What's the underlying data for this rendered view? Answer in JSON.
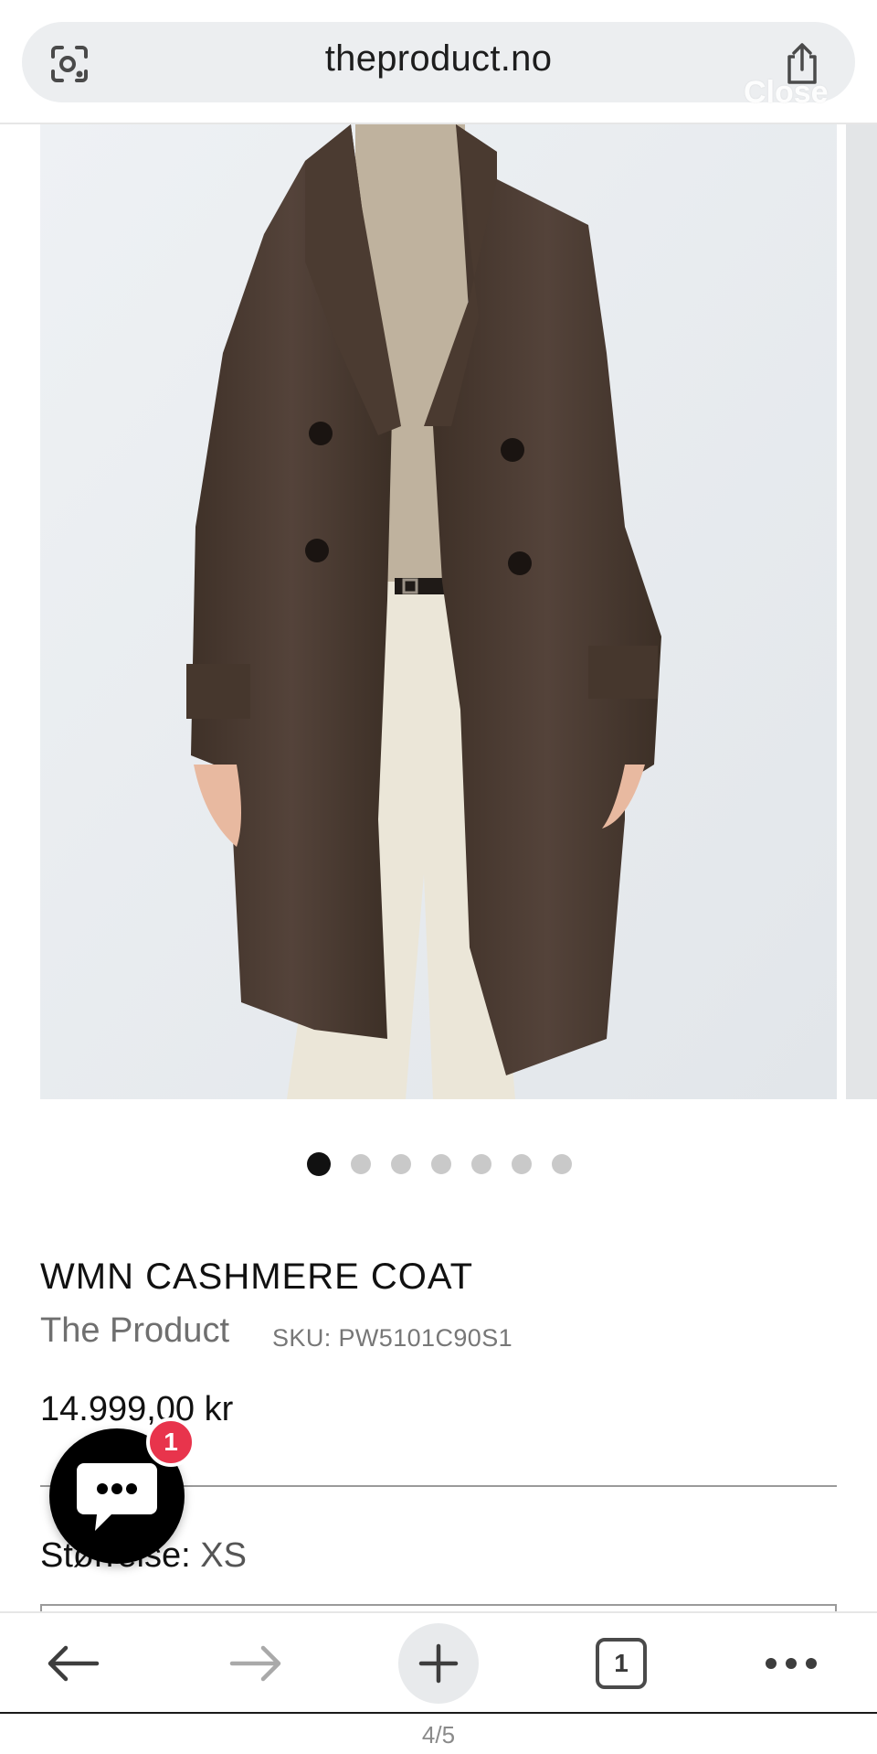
{
  "browser": {
    "url": "theproduct.no",
    "close_overlay": "Close",
    "page_indicator": "4/5",
    "tab_count": "1"
  },
  "gallery": {
    "image_count": 7,
    "active_index": 0
  },
  "product": {
    "title": "WMN CASHMERE COAT",
    "brand": "The Product",
    "sku": "SKU: PW5101C90S1",
    "price": "14.999,00 kr",
    "size_label": "Størrelse:",
    "size_value": "XS"
  },
  "chat": {
    "badge_count": "1"
  },
  "colors": {
    "badge": "#e8344c",
    "chat_button": "#000000",
    "coat": "#4a3a2e"
  },
  "icons": {
    "lens": "google-lens-icon",
    "share": "share-icon",
    "back": "back-arrow-icon",
    "forward": "forward-arrow-icon",
    "new_tab": "plus-icon",
    "tabs": "tab-switcher-icon",
    "more": "more-dots-icon",
    "chat": "chat-bubble-icon"
  }
}
